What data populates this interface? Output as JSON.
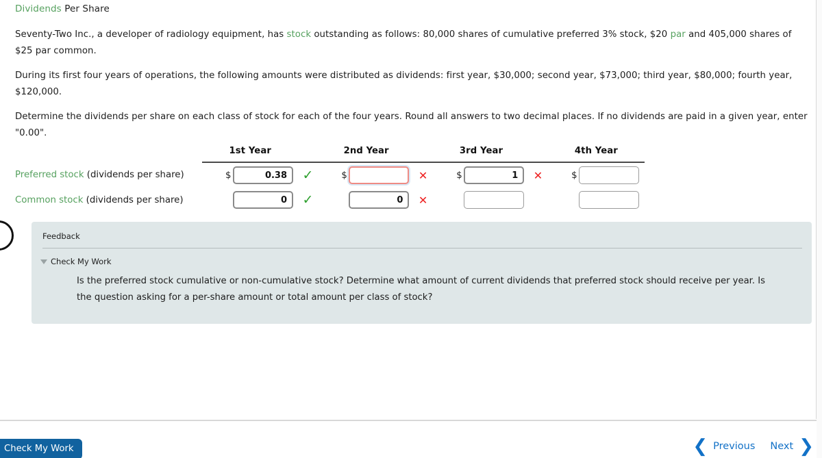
{
  "question": {
    "title_link": "Dividends",
    "title_rest": " Per Share",
    "paragraph_1_a": "Seventy-Two Inc., a developer of radiology equipment, has ",
    "paragraph_1_link": "stock",
    "paragraph_1_b": " outstanding as follows: 80,000 shares of cumulative preferred 3% stock, $20 ",
    "paragraph_1_link2": "par",
    "paragraph_1_c": " and 405,000 shares of $25 par common.",
    "paragraph_2": "During its first four years of operations, the following amounts were distributed as dividends: first year, $30,000; second year, $73,000; third year, $80,000; fourth year, $120,000.",
    "paragraph_3": "Determine the dividends per share on each class of stock for each of the four years. Round all answers to two decimal places. If no dividends are paid in a given year, enter \"0.00\"."
  },
  "table": {
    "column_headers": [
      "",
      "1st Year",
      "2nd Year",
      "3rd Year",
      "4th Year"
    ],
    "rows": [
      {
        "label_link": "Preferred stock",
        "label_rest": " (dividends per share)",
        "cells": [
          {
            "prefix": "$",
            "value": "0.38",
            "mark": "check",
            "focused": false,
            "thin": false
          },
          {
            "prefix": "$",
            "value": "",
            "mark": "cross",
            "focused": true,
            "thin": false
          },
          {
            "prefix": "$",
            "value": "1",
            "mark": "cross",
            "focused": false,
            "thin": false
          },
          {
            "prefix": "$",
            "value": "",
            "mark": "",
            "focused": false,
            "thin": true
          }
        ]
      },
      {
        "label_link": "Common stock",
        "label_rest": " (dividends per share)",
        "cells": [
          {
            "prefix": "",
            "value": "0",
            "mark": "check",
            "focused": false,
            "thin": false
          },
          {
            "prefix": "",
            "value": "0",
            "mark": "cross",
            "focused": false,
            "thin": false
          },
          {
            "prefix": "",
            "value": "",
            "mark": "",
            "focused": false,
            "thin": true
          },
          {
            "prefix": "",
            "value": "",
            "mark": "",
            "focused": false,
            "thin": true
          }
        ]
      }
    ],
    "mark_glyphs": {
      "check": "✓",
      "cross": "✕"
    }
  },
  "feedback": {
    "title": "Feedback",
    "check_my_work_label": "Check My Work",
    "body": "Is the preferred stock cumulative or non-cumulative stock? Determine what amount of current dividends that preferred stock should receive per year. Is the question asking for a per-share amount or total amount per class of stock?"
  },
  "bottom_bar": {
    "check_my_work_button": "Check My Work",
    "previous_label": "Previous",
    "next_label": "Next",
    "previous_chevron": "❮",
    "next_chevron": "❯"
  },
  "colors": {
    "glossary_green": "#56a15f",
    "link_blue": "#1271c7",
    "button_blue": "#11629f",
    "correct_green": "#2ea02e",
    "incorrect_red": "#ee2020",
    "focus_border_red": "#ef8b84",
    "feedback_bg": "#dfe7e8"
  }
}
